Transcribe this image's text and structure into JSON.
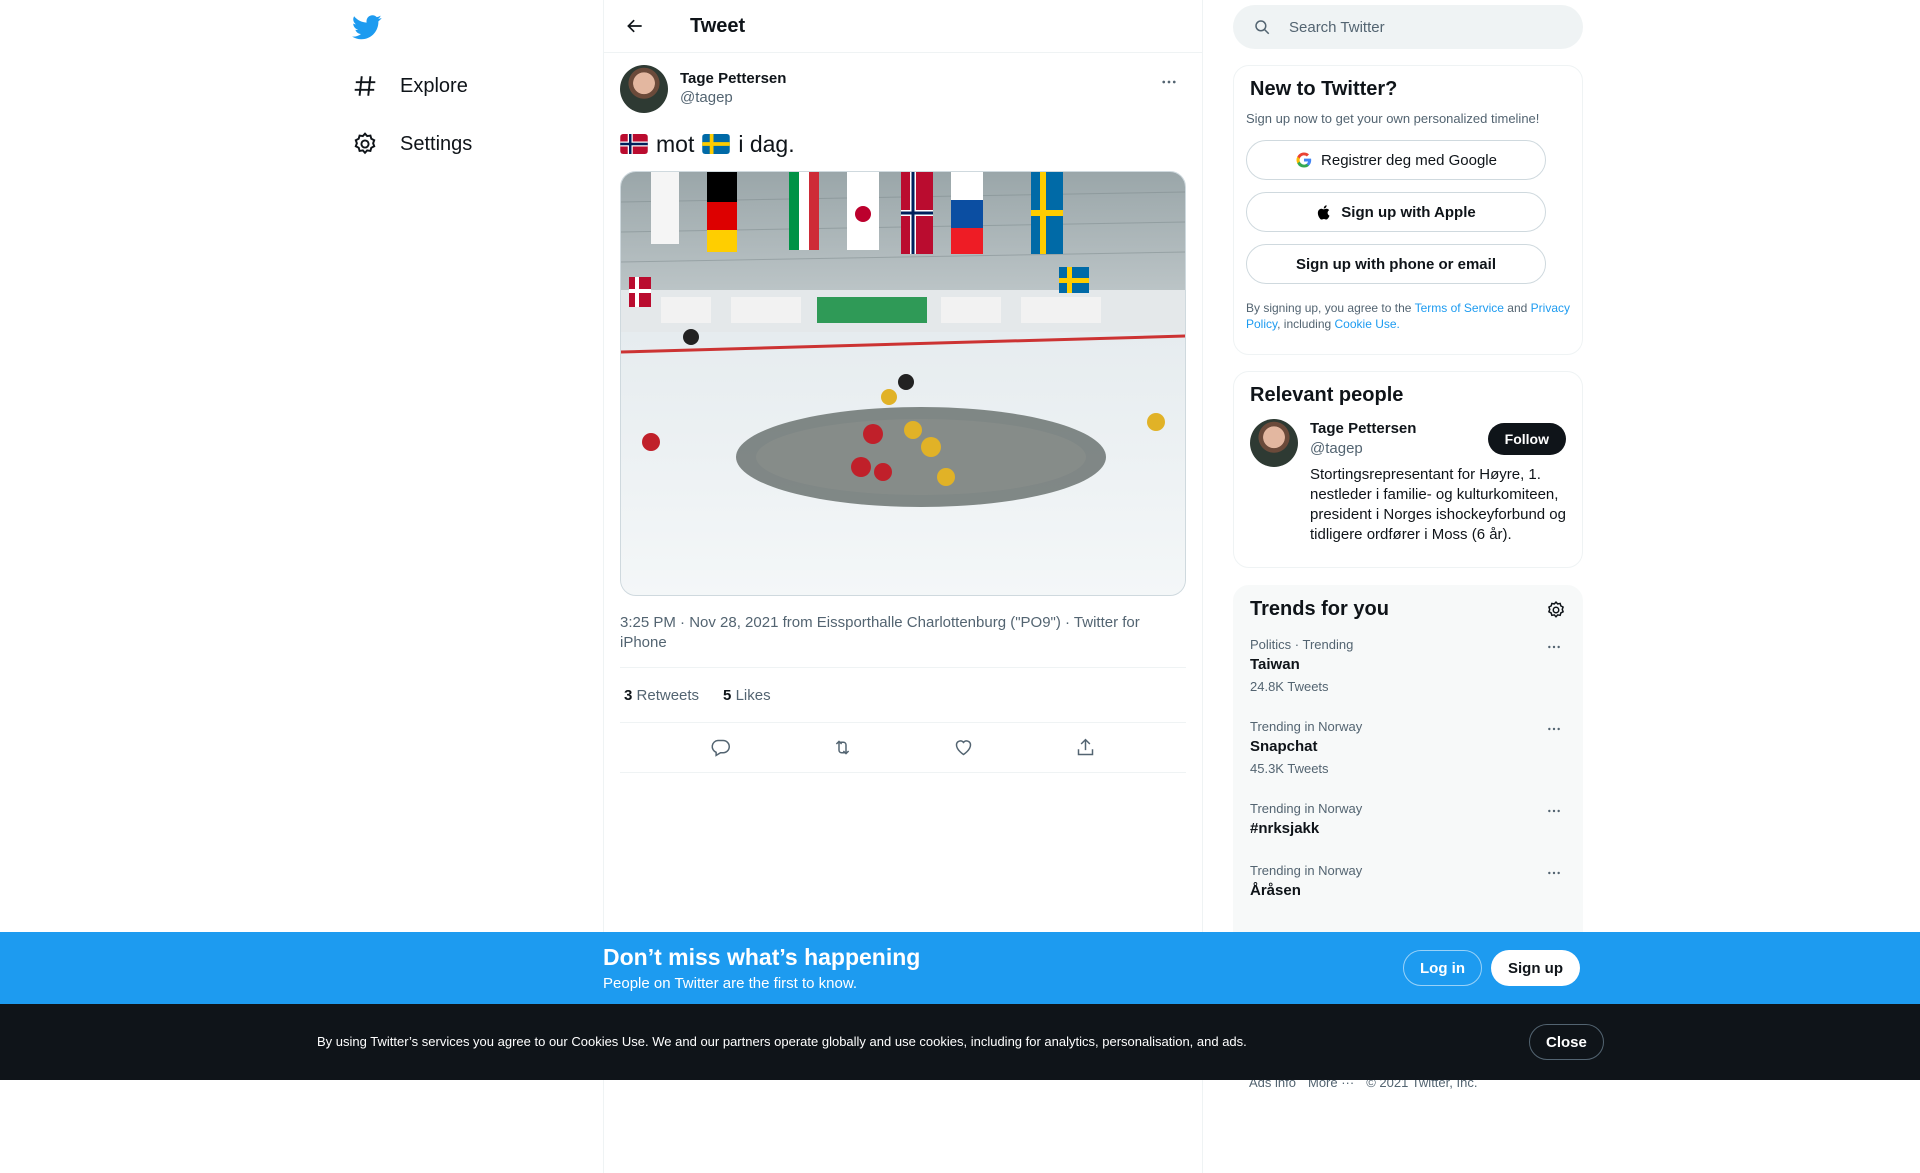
{
  "nav": {
    "logo_icon": "twitter-bird-icon",
    "items": [
      {
        "label": "Explore",
        "icon": "hashtag-icon"
      },
      {
        "label": "Settings",
        "icon": "gear-icon"
      }
    ]
  },
  "header": {
    "title": "Tweet"
  },
  "tweet": {
    "author_name": "Tage Pettersen",
    "author_handle": "@tagep",
    "text_mid": "mot",
    "text_end": "i dag.",
    "meta": "3:25 PM · Nov 28, 2021 from Eissporthalle Charlottenburg (\"PO9\") · Twitter for iPhone",
    "retweets_count": "3",
    "retweets_label": "Retweets",
    "likes_count": "5",
    "likes_label": "Likes"
  },
  "search": {
    "placeholder": "Search Twitter"
  },
  "signup": {
    "title": "New to Twitter?",
    "subtitle": "Sign up now to get your own personalized timeline!",
    "google_label": "Registrer deg med Google",
    "apple_label": "Sign up with Apple",
    "phone_label": "Sign up with phone or email",
    "legal_prefix": "By signing up, you agree to the",
    "tos": "Terms of Service",
    "and": "and",
    "privacy": "Privacy Policy",
    "including": ", including",
    "cookie": "Cookie Use."
  },
  "people": {
    "title": "Relevant people",
    "name": "Tage Pettersen",
    "handle": "@tagep",
    "bio": "Stortingsrepresentant for Høyre, 1. nestleder i familie- og kulturkomiteen, president i Norges ishockeyforbund og tidligere ordfører i Moss (6 år).",
    "follow_label": "Follow"
  },
  "trends": {
    "title": "Trends for you",
    "items": [
      {
        "context": "Politics · Trending",
        "name": "Taiwan",
        "count": "24.8K Tweets"
      },
      {
        "context": "Trending in Norway",
        "name": "Snapchat",
        "count": "45.3K Tweets"
      },
      {
        "context": "Trending in Norway",
        "name": "#nrksjakk",
        "count": ""
      },
      {
        "context": "Trending in Norway",
        "name": "Åråsen",
        "count": ""
      }
    ]
  },
  "footer": {
    "ads": "Ads info",
    "more": "More ···",
    "copyright": "© 2021 Twitter, Inc."
  },
  "promo": {
    "title": "Don’t miss what’s happening",
    "subtitle": "People on Twitter are the first to know.",
    "login_label": "Log in",
    "signup_label": "Sign up"
  },
  "cookie": {
    "text": "By using Twitter’s services you agree to our Cookies Use. We and our partners operate globally and use cookies, including for analytics, personalisation, and ads.",
    "close_label": "Close"
  },
  "colors": {
    "accent": "#1d9bf0",
    "dark": "#0f1419",
    "muted": "#536471"
  }
}
